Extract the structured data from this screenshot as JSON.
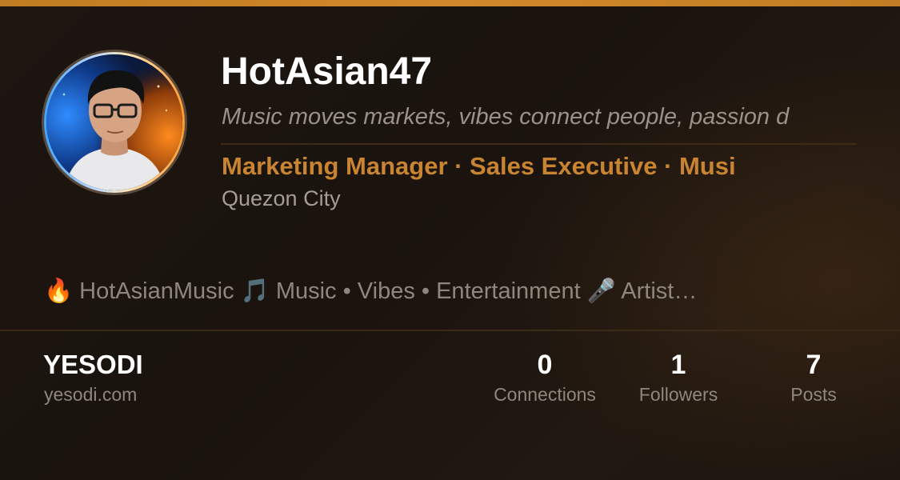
{
  "profile": {
    "name": "HotAsian47",
    "tagline": "Music moves markets, vibes connect people, passion d",
    "roles": "Marketing Manager · Sales Executive · Musi",
    "location": "Quezon City",
    "bio": {
      "icon_1": "🔥",
      "text_1": "HotAsianMusic",
      "icon_2": "🎵",
      "text_2": "Music • Vibes • Entertainment",
      "icon_3": "🎤",
      "text_3": "Artist…"
    }
  },
  "organization": {
    "name": "YESODI",
    "site": "yesodi.com"
  },
  "stats": [
    {
      "value": "0",
      "label": "Connections"
    },
    {
      "value": "1",
      "label": "Followers"
    },
    {
      "value": "7",
      "label": "Posts"
    }
  ],
  "colors": {
    "accent": "#c98432",
    "top_bar": "#c98526",
    "background": "#1a1410"
  }
}
